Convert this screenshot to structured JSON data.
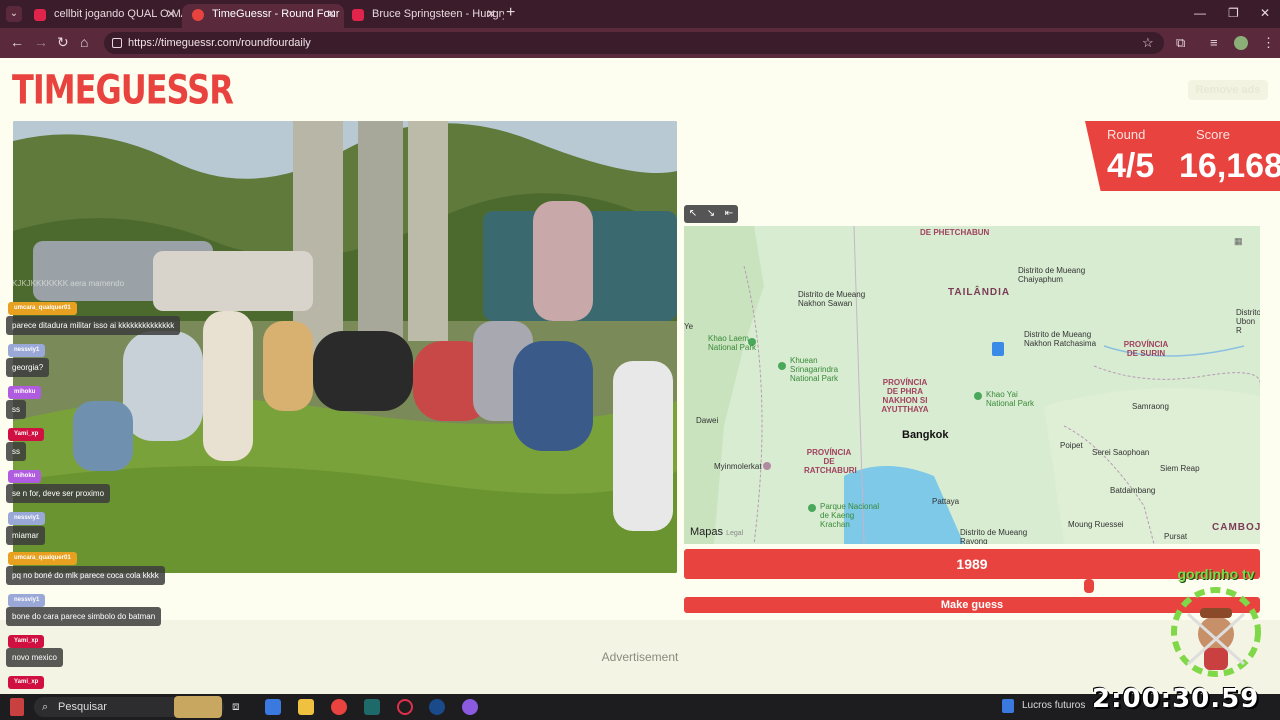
{
  "browser": {
    "tabs": [
      {
        "title": "cellbit jogando QUAL O MAIS P",
        "active": false
      },
      {
        "title": "TimeGuessr - Round Four",
        "active": true
      },
      {
        "title": "Bruce Springsteen - Hungry He",
        "active": false
      }
    ],
    "url": "https://timeguessr.com/roundfourdaily"
  },
  "page": {
    "logo": "TIMEGUESSR",
    "remove_ads": "Remove ads",
    "round_label": "Round",
    "score_label": "Score",
    "round_value": "4/5",
    "score_value": "16,168",
    "year_value": "1989",
    "make_guess": "Make guess",
    "advertisement": "Advertisement",
    "map": {
      "attribution": "Mapas",
      "legal": "Legal",
      "labels": {
        "phetchabun": "DE PHETCHABUN",
        "mueang_chaiyaphum": "Distrito de Mueang Chaiyaphum",
        "mueang_nakhon_sawan": "Distrito de Mueang Nakhon Sawan",
        "tailandia": "TAILÂNDIA",
        "khao_laem": "Khao Laem National Park",
        "mueang_nakhon_ratchasima": "Distrito de Mueang Nakhon Ratchasima",
        "provincia_de_surin": "PROVÍNCIA DE SURIN",
        "mueang_ubon": "Distrito Ubon R",
        "khuean_srinagarindra": "Khuean Srinagarindra National Park",
        "provincia_ayutthaya": "PROVÍNCIA DE PHRA NAKHON SI AYUTTHAYA",
        "khao_yai": "Khao Yai National Park",
        "samraong": "Samraong",
        "dawei": "Dawei",
        "bangkok": "Bangkok",
        "poipet": "Poipet",
        "serei_saophoan": "Serei Saophoan",
        "siem_reap": "Siem Reap",
        "myinmolerkat": "Myinmolerkat",
        "provincia_ratchaburi": "PROVÍNCIA DE RATCHABURI",
        "battambang": "Batdambang",
        "parque_kaeng": "Parque Nacional de Kaeng Krachan",
        "pattaya": "Pattaya",
        "moung_ruessei": "Moung Ruessei",
        "mueang_rayong": "Distrito de Mueang Rayong",
        "pursat": "Pursat",
        "camboja": "CAMBOJ",
        "ye": "Ye"
      }
    }
  },
  "chat": {
    "ghost": "KJKJKKKKKKK aera mamendo",
    "messages": [
      {
        "name": "umcara_qualquer01",
        "text": "parece ditadura militar isso ai kkkkkkkkkkkkkk",
        "color": "#e8a020"
      },
      {
        "name": "nessviy1",
        "text": "georgia?",
        "color": "#9aa8d8"
      },
      {
        "name": "mihoku",
        "text": "ss",
        "color": "#b05ce0"
      },
      {
        "name": "Yami_xp",
        "text": "ss",
        "color": "#d01040"
      },
      {
        "name": "mihoku",
        "text": "se n for, deve ser proximo",
        "color": "#b05ce0"
      },
      {
        "name": "nessviy1",
        "text": "miamar",
        "color": "#9aa8d8"
      },
      {
        "name": "umcara_qualquer01",
        "text": "pq no boné do mlk parece coca cola kkkk",
        "color": "#e8a020"
      },
      {
        "name": "nessviy1",
        "text": "bone do cara parece simbolo do batman",
        "color": "#9aa8d8"
      },
      {
        "name": "Yami_xp",
        "text": "novo mexico",
        "color": "#d01040"
      },
      {
        "name": "Yami_xp",
        "text": "",
        "color": "#d01040"
      }
    ]
  },
  "taskbar": {
    "search": "Pesquisar",
    "news": "Lucros futuros",
    "timer": "2:00:30.59"
  },
  "overlay": {
    "channel_text": "gordinho tv"
  }
}
